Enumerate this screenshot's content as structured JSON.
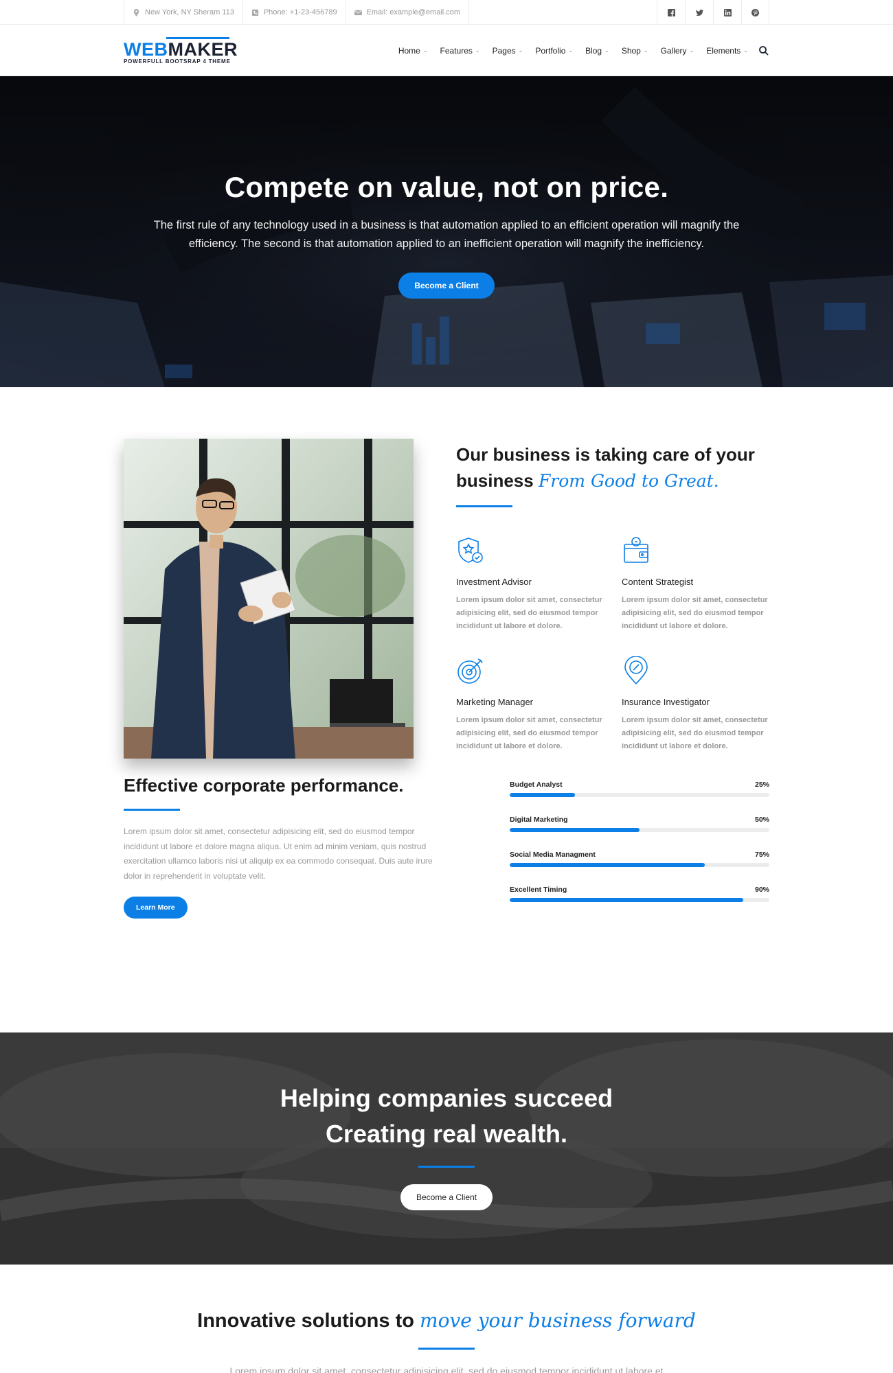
{
  "topbar": {
    "address": "New York, NY Sheram 113",
    "phone": "Phone: +1-23-456789",
    "email": "Email: example@email.com"
  },
  "header": {
    "logo_part1": "WEB",
    "logo_part2": "MAKER",
    "logo_tagline": "POWERFULL BOOTSRAP 4 THEME",
    "nav": [
      "Home",
      "Features",
      "Pages",
      "Portfolio",
      "Blog",
      "Shop",
      "Gallery",
      "Elements"
    ]
  },
  "hero": {
    "title": "Compete on value, not on price.",
    "text": "The first rule of any technology used in a business is that automation applied to an efficient operation will magnify the efficiency. The second is that automation applied to an inefficient operation will magnify the inefficiency.",
    "button": "Become a Client"
  },
  "about": {
    "title_line1": "Our business is taking care of your",
    "title_line2": "business",
    "title_script": "From Good to Great.",
    "features": [
      {
        "icon": "shield-star-icon",
        "title": "Investment Advisor",
        "text": "Lorem ipsum dolor sit amet, consectetur adipisicing elit, sed do eiusmod tempor incididunt ut labore et dolore."
      },
      {
        "icon": "wallet-icon",
        "title": "Content Strategist",
        "text": "Lorem ipsum dolor sit amet, consectetur adipisicing elit, sed do eiusmod tempor incididunt ut labore et dolore."
      },
      {
        "icon": "target-icon",
        "title": "Marketing Manager",
        "text": "Lorem ipsum dolor sit amet, consectetur adipisicing elit, sed do eiusmod tempor incididunt ut labore et dolore."
      },
      {
        "icon": "compass-pin-icon",
        "title": "Insurance Investigator",
        "text": "Lorem ipsum dolor sit amet, consectetur adipisicing elit, sed do eiusmod tempor incididunt ut labore et dolore."
      }
    ]
  },
  "performance": {
    "title": "Effective corporate performance.",
    "text": "Lorem ipsum dolor sit amet, consectetur adipisicing elit, sed do eiusmod tempor incididunt ut labore et dolore magna aliqua. Ut enim ad minim veniam, quis nostrud exercitation ullamco laboris nisi ut aliquip ex ea commodo consequat. Duis aute irure dolor in reprehenderit in voluptate velit.",
    "button": "Learn More",
    "bars": [
      {
        "label": "Budget Analyst",
        "value": 25,
        "value_text": "25%"
      },
      {
        "label": "Digital Marketing",
        "value": 50,
        "value_text": "50%"
      },
      {
        "label": "Social Media Managment",
        "value": 75,
        "value_text": "75%"
      },
      {
        "label": "Excellent Timing",
        "value": 90,
        "value_text": "90%"
      }
    ]
  },
  "cta": {
    "line1": "Helping companies succeed",
    "line2": "Creating real wealth.",
    "button": "Become a Client"
  },
  "innovative": {
    "title": "Innovative solutions to",
    "title_script": "move your business forward",
    "text": "Lorem ipsum dolor sit amet, consectetur adipisicing elit, sed do eiusmod tempor incididunt ut labore et dolore magna aliqua. Ut enim ad minim veniam."
  },
  "colors": {
    "accent": "#0c7fe6",
    "dark": "#1b2233"
  }
}
